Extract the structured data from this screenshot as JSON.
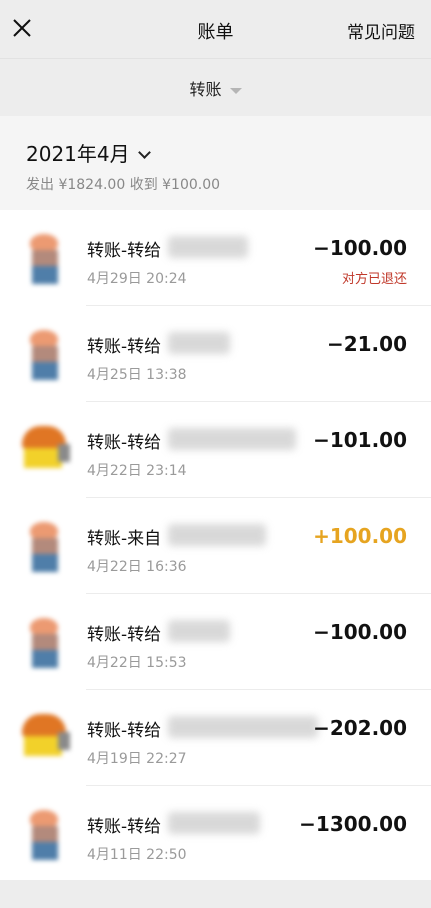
{
  "header": {
    "title": "账单",
    "faq_label": "常见问题"
  },
  "filter": {
    "label": "转账"
  },
  "month": {
    "label": "2021年4月",
    "summary": "发出 ¥1824.00 收到 ¥100.00"
  },
  "transactions": [
    {
      "title": "转账-转给",
      "time": "4月29日 20:24",
      "amount": "−100.00",
      "status": "对方已退还"
    },
    {
      "title": "转账-转给",
      "time": "4月25日 13:38",
      "amount": "−21.00",
      "status": ""
    },
    {
      "title": "转账-转给",
      "time": "4月22日 23:14",
      "amount": "−101.00",
      "status": ""
    },
    {
      "title": "转账-来自",
      "time": "4月22日 16:36",
      "amount": "+100.00",
      "status": ""
    },
    {
      "title": "转账-转给",
      "time": "4月22日 15:53",
      "amount": "−100.00",
      "status": ""
    },
    {
      "title": "转账-转给",
      "time": "4月19日 22:27",
      "amount": "−202.00",
      "status": ""
    },
    {
      "title": "转账-转给",
      "time": "4月11日 22:50",
      "amount": "−1300.00",
      "status": ""
    }
  ],
  "colors": {
    "positive_amount": "#e6a420",
    "refund_status": "#c0392b",
    "background": "#ededed"
  }
}
